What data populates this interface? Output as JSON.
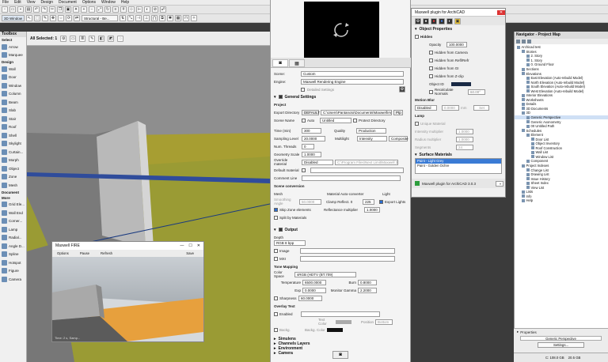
{
  "menu": [
    "File",
    "Edit",
    "View",
    "Design",
    "Document",
    "Options",
    "Window",
    "Help"
  ],
  "toolbar": {
    "window_btn": "3D Window",
    "all_selected": "All Selected: 1",
    "floor_label": "Structural - Be...",
    "toolbox_title": "Toolbox",
    "select": "Select"
  },
  "toolbox": {
    "tools": [
      "Arrow",
      "Marquee",
      "Design",
      "Wall",
      "Door",
      "Window",
      "Column",
      "Beam",
      "Slab",
      "Stair",
      "Roof",
      "Shell",
      "Skylight",
      "Curtain...",
      "Morph",
      "Object",
      "Zone",
      "Mesh",
      "Document",
      "More",
      "Grid Ele...",
      "Wall End",
      "Corner...",
      "Lamp",
      "Radial...",
      "Angle D...",
      "Spline",
      "Hotspot",
      "Figure",
      "Camera"
    ]
  },
  "maxwell": {
    "preview_icon": "refresh-icon",
    "scene_label": "Scene:",
    "scene_value": "Custom",
    "engine_label": "Engine:",
    "engine_value": "Maxwell Rendering Engine",
    "detailed": "Detailed Settings",
    "general_title": "General Settings",
    "project_title": "Project",
    "export_dir_label": "Export Directory",
    "export_default": "DEFAULT",
    "export_path": "C:\\Users\\Pantanoto\\Documents\\Maxwell\\Ar\\Hmn",
    "export_browse": "Ptp",
    "scene_name_label": "Scene Name",
    "auto": "Auto",
    "scene_name": "Untitled",
    "protect_dir": "Protect Directory",
    "time_label": "Time (min)",
    "time_value": "300",
    "quality_label": "Quality",
    "quality_value": "Production",
    "sl_label": "Sampling Level",
    "sl_value": "20.0000",
    "multilight_label": "Multilight",
    "multilight_value": "Intensity",
    "multilight_mode": "Composite",
    "threads_label": "Num. Threads",
    "threads_value": "0",
    "scale_label": "Geometry Scale",
    "scale_value": "1.0000",
    "override_label": "Override material",
    "override_value": "Disabled",
    "override_path": "C:\\Program Files\\Next Limit\\Maxwell 3\\mater",
    "default_label": "Default material",
    "comment_label": "Comment Line",
    "scene_conv": "Scene conversion",
    "mesh": "Mesh",
    "smoothing_label": "Smoothing Angle",
    "smoothing_value": "50.0000",
    "skip_zone": "Skip Zone elements",
    "split_mat": "Split by Materials",
    "matconv": "Material Auto-converter",
    "clamp_label": "Clamp Reflect. 0",
    "clamp_value": "225",
    "reflectance_label": "Reflectance multiplier",
    "reflectance_value": "1.0000",
    "light": "Light",
    "export_lights": "Export Lights",
    "output_title": "Output",
    "depth_label": "Depth",
    "depth_value": "RGB 8 bpp",
    "image_label": "Image",
    "mxi_label": "MXI",
    "tonemap_title": "Tone Mapping",
    "cs_label": "Color Space",
    "cs_value": "sRGB (HDTV (BT.709)",
    "temp_label": "Temperature",
    "temp_value": "6500.0000",
    "burn_label": "Burn",
    "burn_value": "0.8000",
    "exp_label": "Exp",
    "exp_value": "0.0000",
    "gamma_label": "Monitor Gamma",
    "gamma_value": "2.2000",
    "sharpness_label": "Sharpness",
    "sharpness_value": "60.0000",
    "overlay_title": "Overlay Text",
    "enabled": "Enabled",
    "text_color": "Text Color",
    "position": "Position",
    "position_value": "Bottom",
    "backg": "Backg.",
    "backg_color": "Backg. Color",
    "simulens": "Simulens",
    "channels": "Channels Layers",
    "environment": "Environment",
    "camera": "Camera"
  },
  "plugin": {
    "title": "Maxwell plugin for ArchiCAD",
    "obj_props": "Object Properties",
    "hidden": "Hidden",
    "opacity_label": "Opacity",
    "opacity_value": "100.0000",
    "hid_camera": "Hidden from Camera",
    "hid_refl": "Hidden from Refl/Refr",
    "hid_gi": "Hidden from GI",
    "hid_zclip": "Hidden from Z-clip",
    "objectid_label": "Object ID",
    "recalc": "Recalculate Normals",
    "recalc_value": "60.00°",
    "motion_blur": "Motion Blur",
    "mb_value": "Disabled",
    "mb_num": "0.0000",
    "mb_unit": "mm",
    "mb_btn": "Set",
    "lamp": "Lamp",
    "unique": "Unique Material",
    "int_label": "Intensity multiplier",
    "int_value": "1.0000",
    "radius_label": "Radius multiplier",
    "radius_value": "1.0000",
    "seg_label": "Segments",
    "seg_value": "24",
    "surface": "Surface Materials",
    "materials": [
      "Paint - Light Grey",
      "Paint - Golden Ochre"
    ],
    "footer": "Maxwell plugin for ArchiCAD 3.0.3"
  },
  "navigator": {
    "title": "Navigator - Project Map",
    "items": [
      {
        "l": "Archicad test",
        "d": 0
      },
      {
        "l": "Stories",
        "d": 1
      },
      {
        "l": "2. Story",
        "d": 2
      },
      {
        "l": "1. Story",
        "d": 2
      },
      {
        "l": "0. Ground Floor",
        "d": 2
      },
      {
        "l": "Sections",
        "d": 1
      },
      {
        "l": "Elevations",
        "d": 1
      },
      {
        "l": "East Elevation (Auto-rebuild Model)",
        "d": 2
      },
      {
        "l": "North Elevation (Auto-rebuild Model)",
        "d": 2
      },
      {
        "l": "South Elevation (Auto-rebuild Model)",
        "d": 2
      },
      {
        "l": "West Elevation (Auto-rebuild Model)",
        "d": 2
      },
      {
        "l": "Interior Elevations",
        "d": 1
      },
      {
        "l": "Worksheets",
        "d": 1
      },
      {
        "l": "Details",
        "d": 1
      },
      {
        "l": "3D Documents",
        "d": 1
      },
      {
        "l": "3D",
        "d": 1
      },
      {
        "l": "Generic Perspective",
        "d": 2
      },
      {
        "l": "Generic Axonometry",
        "d": 2
      },
      {
        "l": "00 Untitled Path",
        "d": 2
      },
      {
        "l": "Schedules",
        "d": 1
      },
      {
        "l": "Element",
        "d": 2
      },
      {
        "l": "Door List",
        "d": 3
      },
      {
        "l": "Object Inventory",
        "d": 3
      },
      {
        "l": "Roof Construction",
        "d": 3
      },
      {
        "l": "Wall List",
        "d": 3
      },
      {
        "l": "Window List",
        "d": 3
      },
      {
        "l": "Component",
        "d": 2
      },
      {
        "l": "Project Indexes",
        "d": 1
      },
      {
        "l": "Change List",
        "d": 2
      },
      {
        "l": "Drawing List",
        "d": 2
      },
      {
        "l": "Issue History",
        "d": 2
      },
      {
        "l": "Sheet Index",
        "d": 2
      },
      {
        "l": "View List",
        "d": 2
      },
      {
        "l": "Lists",
        "d": 1
      },
      {
        "l": "Info",
        "d": 1
      },
      {
        "l": "Help",
        "d": 1
      }
    ],
    "properties": "Properties",
    "props_value": "Generic Perspective",
    "settings": "Settings..."
  },
  "fire": {
    "title": "Maxwell FIRE",
    "menu": [
      "Options",
      "Pause",
      "Refresh",
      "Save"
    ],
    "status": "Time: 2 s, Samp..."
  },
  "status": {
    "disk": "C: 108.0 GB",
    "ram": "20.5 GB"
  }
}
